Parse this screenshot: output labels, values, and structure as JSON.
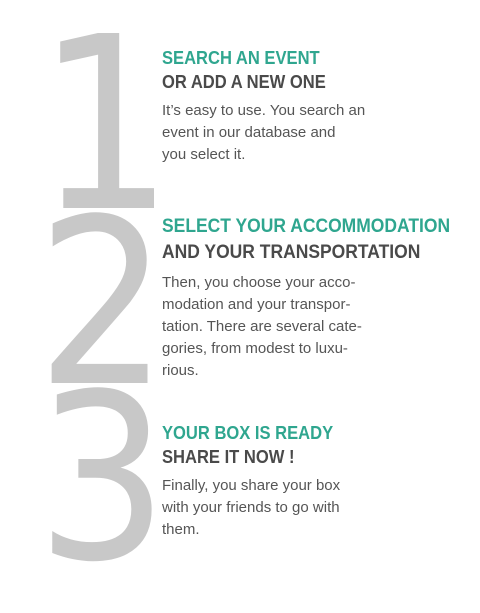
{
  "steps": [
    {
      "number": "1",
      "title_accent": "SEARCH AN EVENT",
      "title_dark": "OR ADD A NEW ONE",
      "description_lines": [
        "It’s easy to use. You search an",
        "event in our database and",
        "you select it."
      ]
    },
    {
      "number": "2",
      "title_accent": "SELECT YOUR ACCOMMODATION",
      "title_dark": "AND YOUR TRANSPORTATION",
      "description_lines": [
        "Then, you choose your acco-",
        "modation and your transpor-",
        "tation. There are several cate-",
        "gories, from modest to luxu-",
        "rious."
      ]
    },
    {
      "number": "3",
      "title_accent": "YOUR BOX IS READY",
      "title_dark": "SHARE IT NOW !",
      "description_lines": [
        "Finally, you share your box",
        "with your friends to go with",
        "them."
      ]
    }
  ],
  "colors": {
    "accent": "#2fa68f",
    "heading_dark": "#4a4a4a",
    "body_text": "#555555",
    "numeral": "#c8c8c8"
  }
}
